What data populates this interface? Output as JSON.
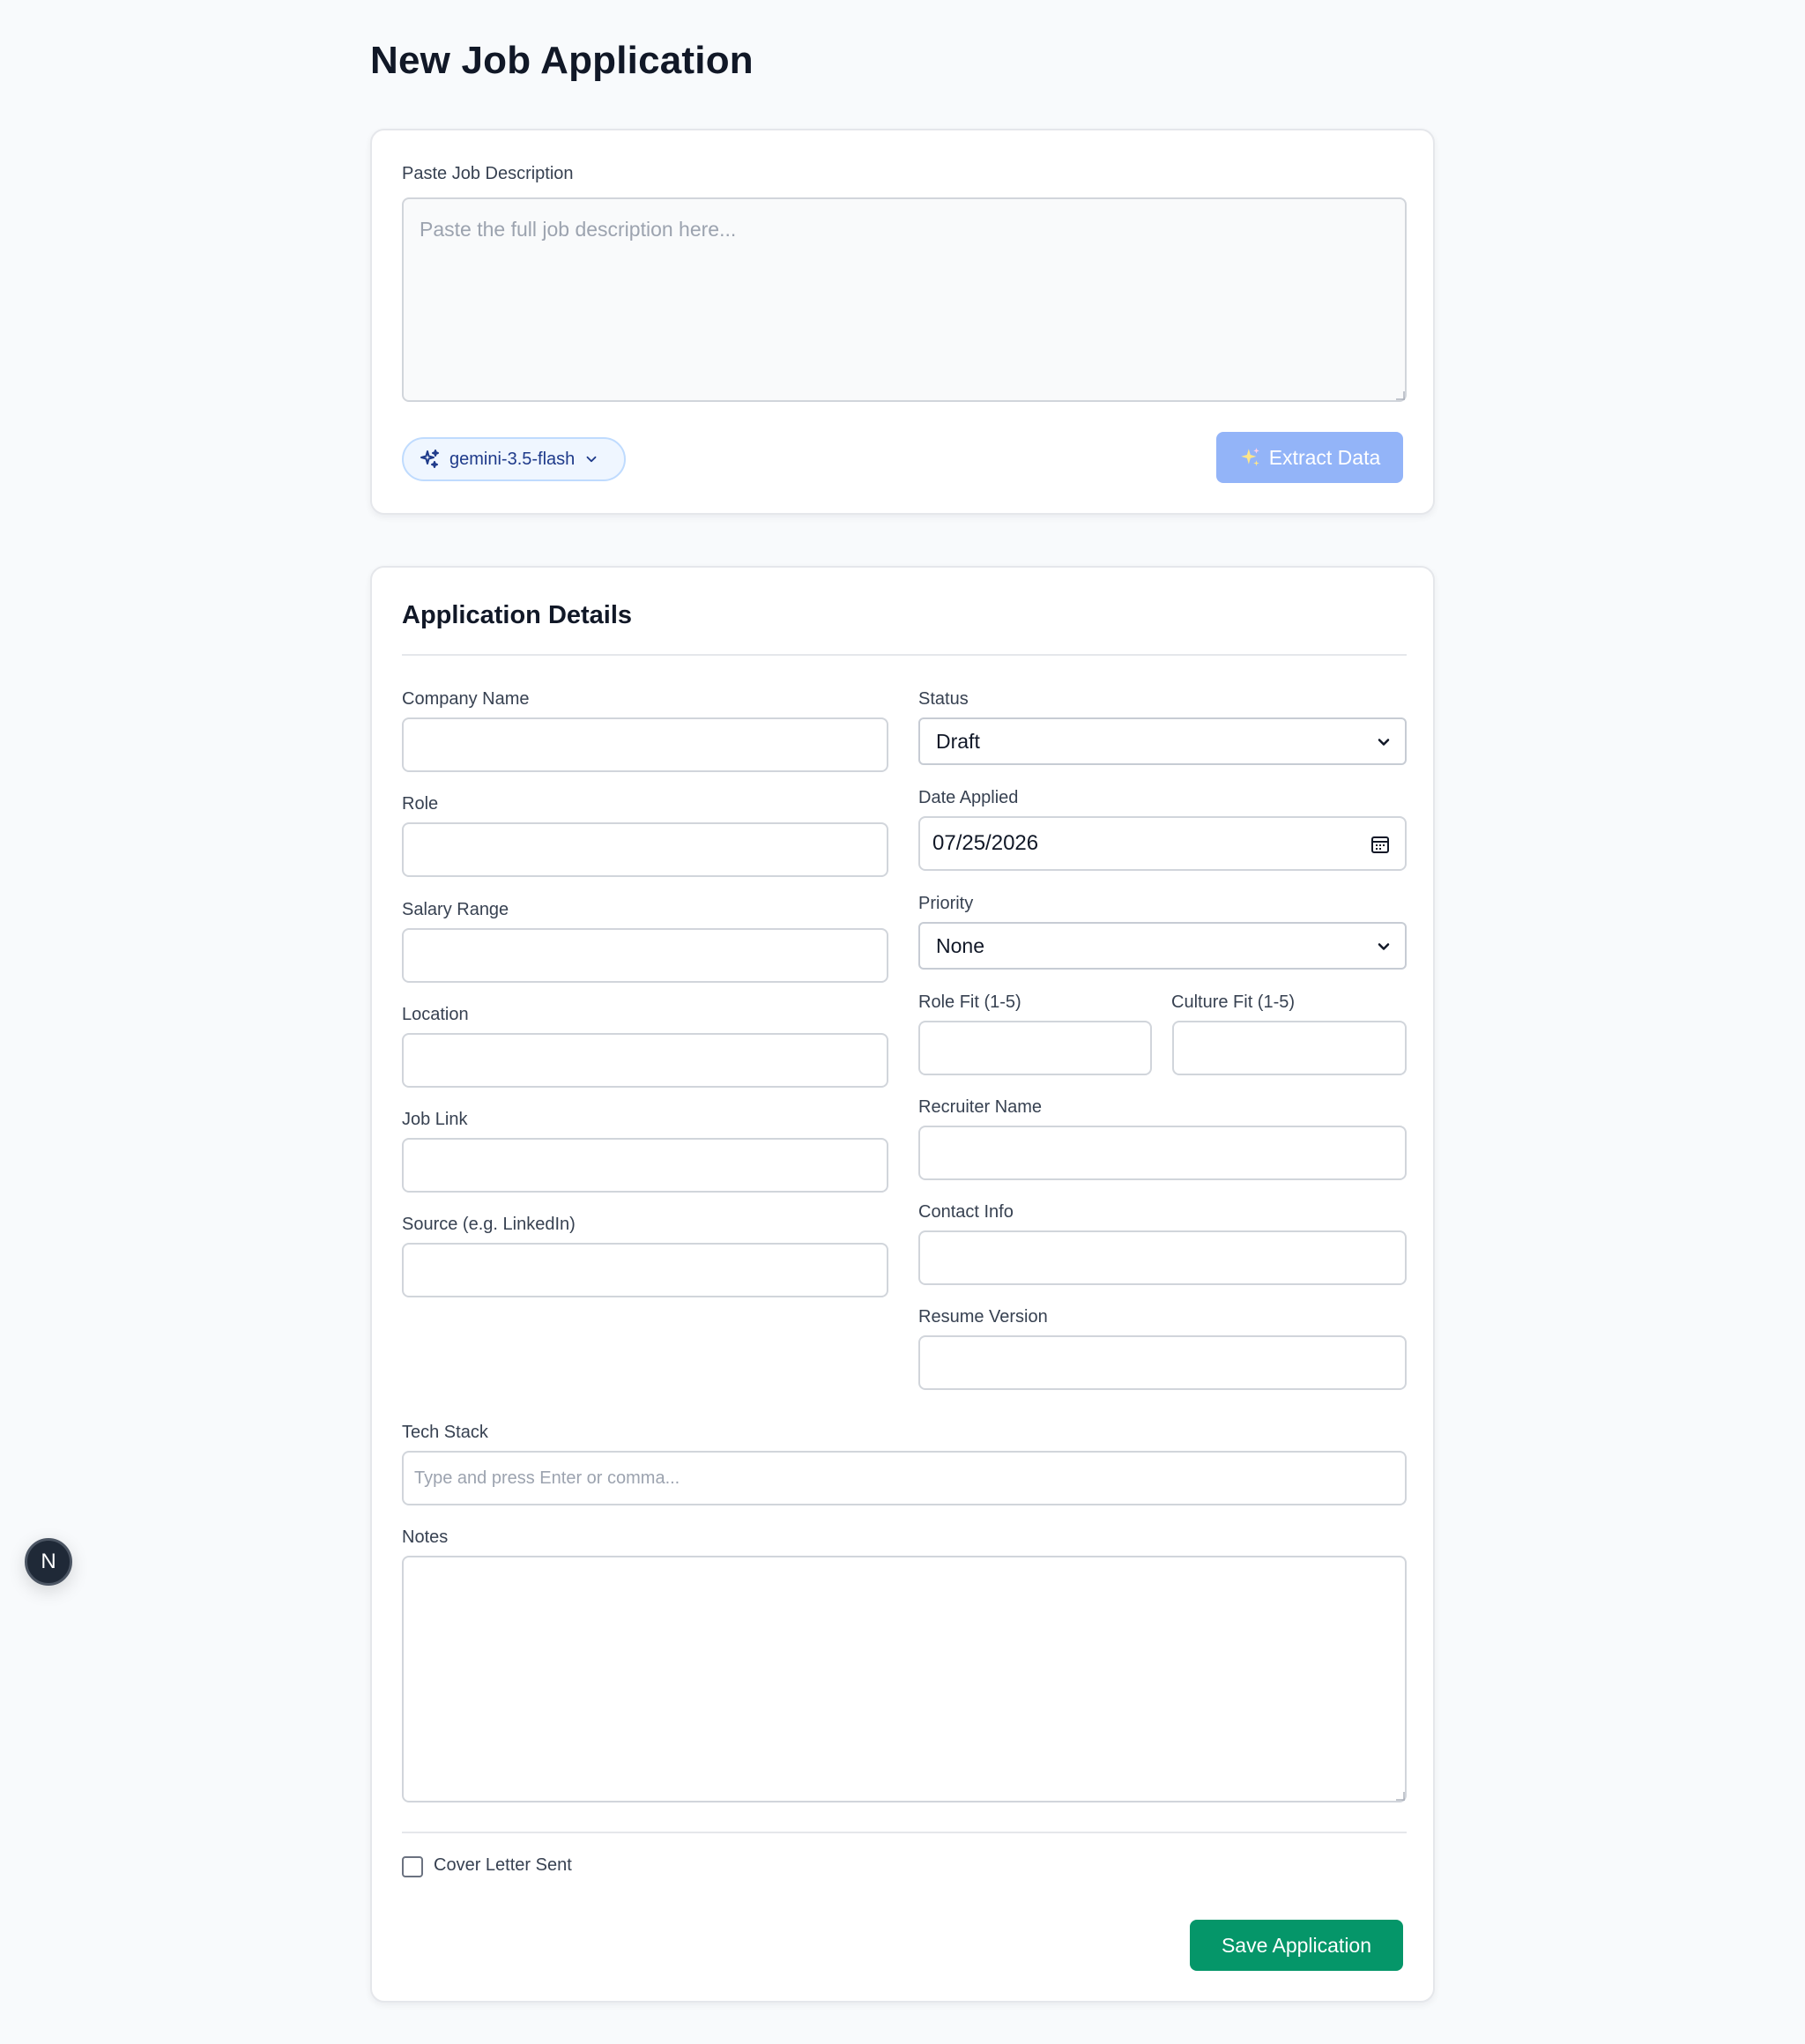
{
  "page": {
    "title": "New Job Application"
  },
  "job_description": {
    "label": "Paste Job Description",
    "placeholder": "Paste the full job description here...",
    "model": "gemini-3.5-flash",
    "extract_label": "Extract Data"
  },
  "details": {
    "title": "Application Details",
    "company_label": "Company Name",
    "role_label": "Role",
    "salary_label": "Salary Range",
    "location_label": "Location",
    "job_link_label": "Job Link",
    "source_label": "Source (e.g. LinkedIn)",
    "status_label": "Status",
    "status_value": "Draft",
    "date_label": "Date Applied",
    "date_value": "07/25/2026",
    "priority_label": "Priority",
    "priority_value": "None",
    "role_fit_label": "Role Fit (1-5)",
    "culture_fit_label": "Culture Fit (1-5)",
    "recruiter_label": "Recruiter Name",
    "contact_label": "Contact Info",
    "resume_label": "Resume Version",
    "tech_stack_label": "Tech Stack",
    "tech_stack_placeholder": "Type and press Enter or comma...",
    "notes_label": "Notes",
    "cover_letter_label": "Cover Letter Sent",
    "save_label": "Save Application"
  },
  "floating": {
    "badge_letter": "N"
  },
  "colors": {
    "primary_blue_disabled": "#93b4f8",
    "save_green": "#059669",
    "pill_bg": "#eff6ff",
    "pill_text": "#1e3a8a"
  },
  "icons": {
    "model": "sparkle-cluster-icon",
    "extract": "sparkles-icon",
    "calendar": "calendar-icon",
    "chevron": "chevron-down-icon"
  }
}
